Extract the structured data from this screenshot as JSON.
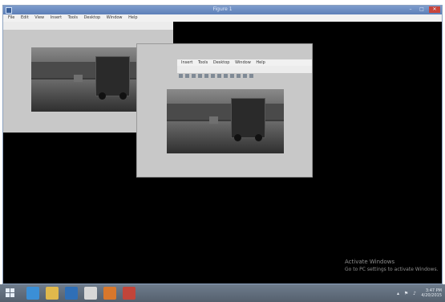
{
  "window": {
    "title": "Figure 1",
    "menu": [
      "File",
      "Edit",
      "View",
      "Insert",
      "Tools",
      "Desktop",
      "Window",
      "Help"
    ]
  },
  "figure2": {
    "menu": [
      "Insert",
      "Tools",
      "Desktop",
      "Window",
      "Help"
    ]
  },
  "watermark": {
    "title": "Activate Windows",
    "subtitle": "Go to PC settings to activate Windows."
  },
  "taskbar": {
    "time": "3:47 PM",
    "date": "4/20/2015",
    "apps": [
      "internet-explorer",
      "file-explorer",
      "windows-media-player",
      "notepad",
      "matlab",
      "video-player"
    ]
  },
  "colors": {
    "desktop_bg": "#000000",
    "figure_bg": "#c8c8c8",
    "titlebar": "#5c7fb8",
    "taskbar": "#5f6b79"
  }
}
